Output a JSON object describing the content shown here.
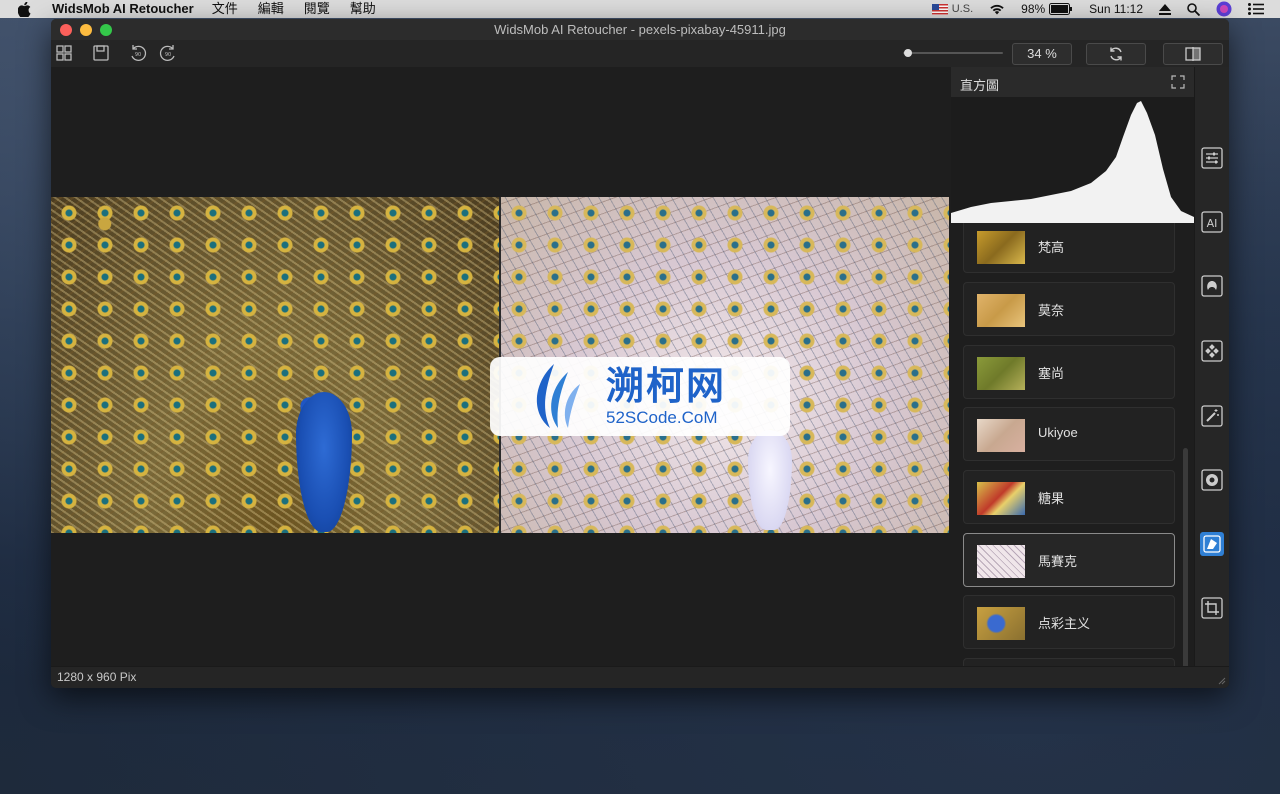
{
  "menubar": {
    "app_name": "WidsMob AI Retoucher",
    "menus": [
      "文件",
      "編輯",
      "閱覽",
      "幫助"
    ],
    "input_source": "U.S.",
    "battery": "98%",
    "clock": "Sun 11:12"
  },
  "window": {
    "title": "WidsMob AI Retoucher - pexels-pixabay-45911.jpg"
  },
  "toolbar": {
    "zoom_value": 0.34,
    "zoom_label": "34 %"
  },
  "watermark": {
    "title": "溯柯网",
    "subtitle": "52SCode.CoM"
  },
  "status": {
    "dimensions": "1280 x 960 Pix"
  },
  "panel": {
    "histogram_title": "直方圖",
    "filters": [
      {
        "label": "梵高",
        "selected": false
      },
      {
        "label": "莫奈",
        "selected": false
      },
      {
        "label": "塞尚",
        "selected": false
      },
      {
        "label": "Ukiyoe",
        "selected": false
      },
      {
        "label": "糖果",
        "selected": false
      },
      {
        "label": "馬賽克",
        "selected": true
      },
      {
        "label": "点彩主义",
        "selected": false
      }
    ]
  },
  "tools": [
    "adjust-icon",
    "ai-icon",
    "portrait-icon",
    "noise-icon",
    "magic-wand-icon",
    "lens-icon",
    "style-icon",
    "crop-icon"
  ],
  "colors": {
    "accent": "#2f7fd4",
    "watermark": "#1f63c9"
  }
}
